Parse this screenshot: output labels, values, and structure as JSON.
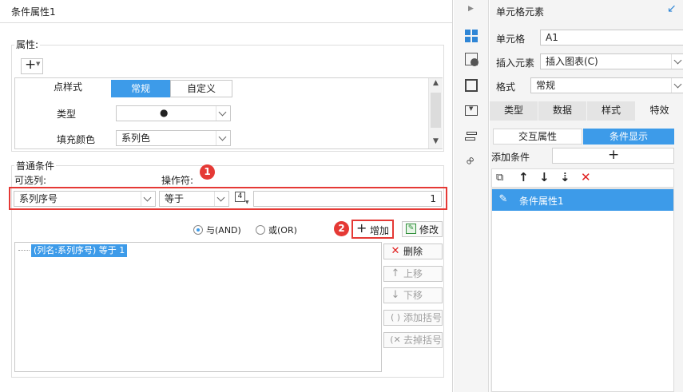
{
  "left_panel": {
    "title": "条件属性1",
    "attr_section": {
      "label": "属性:",
      "add_symbol": "+",
      "rows": [
        {
          "label": "点样式",
          "tabs": [
            "常规",
            "自定义"
          ],
          "active": 0
        },
        {
          "label": "类型",
          "value": "●"
        },
        {
          "label": "填充颜色",
          "value": "系列色"
        }
      ]
    },
    "condition_section": {
      "label": "普通条件",
      "column_label": "可选列:",
      "operator_label": "操作符:",
      "column_value": "系列序号",
      "operator_value": "等于",
      "type_icon": "4",
      "value": "1",
      "marker1": "1",
      "marker2": "2",
      "and_label": "与(AND)",
      "or_label": "或(OR)",
      "selected_logic": "and",
      "add_button": "增加",
      "modify_button": "修改",
      "conditions": [
        "(列名:系列序号) 等于 1"
      ],
      "buttons": {
        "delete": "删除",
        "move_up": "上移",
        "move_down": "下移",
        "add_bracket": "添加括号",
        "remove_bracket": "去掉括号"
      }
    }
  },
  "right_panel": {
    "title": "单元格元素",
    "cell_label": "单元格",
    "cell_value": "A1",
    "insert_label": "插入元素",
    "insert_value": "插入图表(C)",
    "format_label": "格式",
    "format_value": "常规",
    "tabs": [
      "类型",
      "数据",
      "样式",
      "特效"
    ],
    "sub_tabs": [
      "交互属性",
      "条件显示"
    ],
    "add_condition_label": "添加条件",
    "add_symbol": "+",
    "list_items": [
      "条件属性1"
    ]
  },
  "colors": {
    "accent": "#3d9be9",
    "selection": "#3d9be9",
    "marker": "#e53935"
  }
}
